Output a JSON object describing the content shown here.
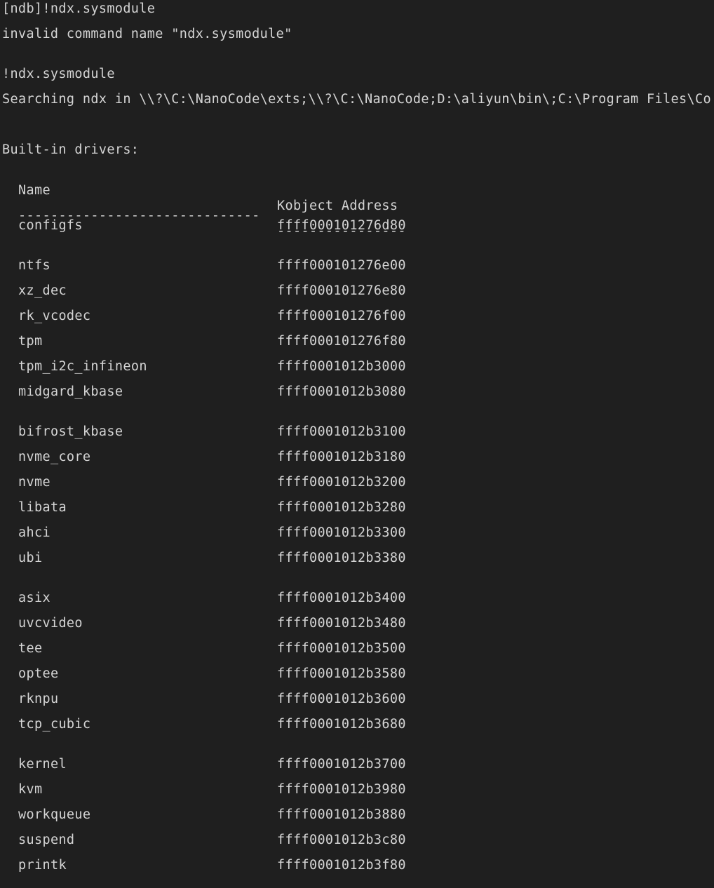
{
  "console": {
    "lines": [
      "[ndb]!ndx.sysmodule",
      "invalid command name \"ndx.sysmodule\"",
      "!ndx.sysmodule",
      "Searching ndx in \\\\?\\C:\\NanoCode\\exts;\\\\?\\C:\\NanoCode;D:\\aliyun\\bin\\;C:\\Program Files\\Co",
      "Built-in drivers:"
    ],
    "table": {
      "headers": [
        "Name",
        "Kobject Address"
      ],
      "separators": [
        "------------------------------",
        "----------------"
      ],
      "rows": [
        [
          "configfs",
          "ffff000101276d80"
        ],
        [
          "ntfs",
          "ffff000101276e00"
        ],
        [
          "xz_dec",
          "ffff000101276e80"
        ],
        [
          "rk_vcodec",
          "ffff000101276f00"
        ],
        [
          "tpm",
          "ffff000101276f80"
        ],
        [
          "tpm_i2c_infineon",
          "ffff0001012b3000"
        ],
        [
          "midgard_kbase",
          "ffff0001012b3080"
        ],
        [
          "bifrost_kbase",
          "ffff0001012b3100"
        ],
        [
          "nvme_core",
          "ffff0001012b3180"
        ],
        [
          "nvme",
          "ffff0001012b3200"
        ],
        [
          "libata",
          "ffff0001012b3280"
        ],
        [
          "ahci",
          "ffff0001012b3300"
        ],
        [
          "ubi",
          "ffff0001012b3380"
        ],
        [
          "asix",
          "ffff0001012b3400"
        ],
        [
          "uvcvideo",
          "ffff0001012b3480"
        ],
        [
          "tee",
          "ffff0001012b3500"
        ],
        [
          "optee",
          "ffff0001012b3580"
        ],
        [
          "rknpu",
          "ffff0001012b3600"
        ],
        [
          "tcp_cubic",
          "ffff0001012b3680"
        ],
        [
          "kernel",
          "ffff0001012b3700"
        ],
        [
          "kvm",
          "ffff0001012b3980"
        ],
        [
          "workqueue",
          "ffff0001012b3880"
        ],
        [
          "suspend",
          "ffff0001012b3c80"
        ],
        [
          "printk",
          "ffff0001012b3f80"
        ],
        [
          "",
          ""
        ]
      ]
    }
  },
  "colors": {
    "background": "#1f1f1f",
    "text": "#d4d4d4"
  }
}
